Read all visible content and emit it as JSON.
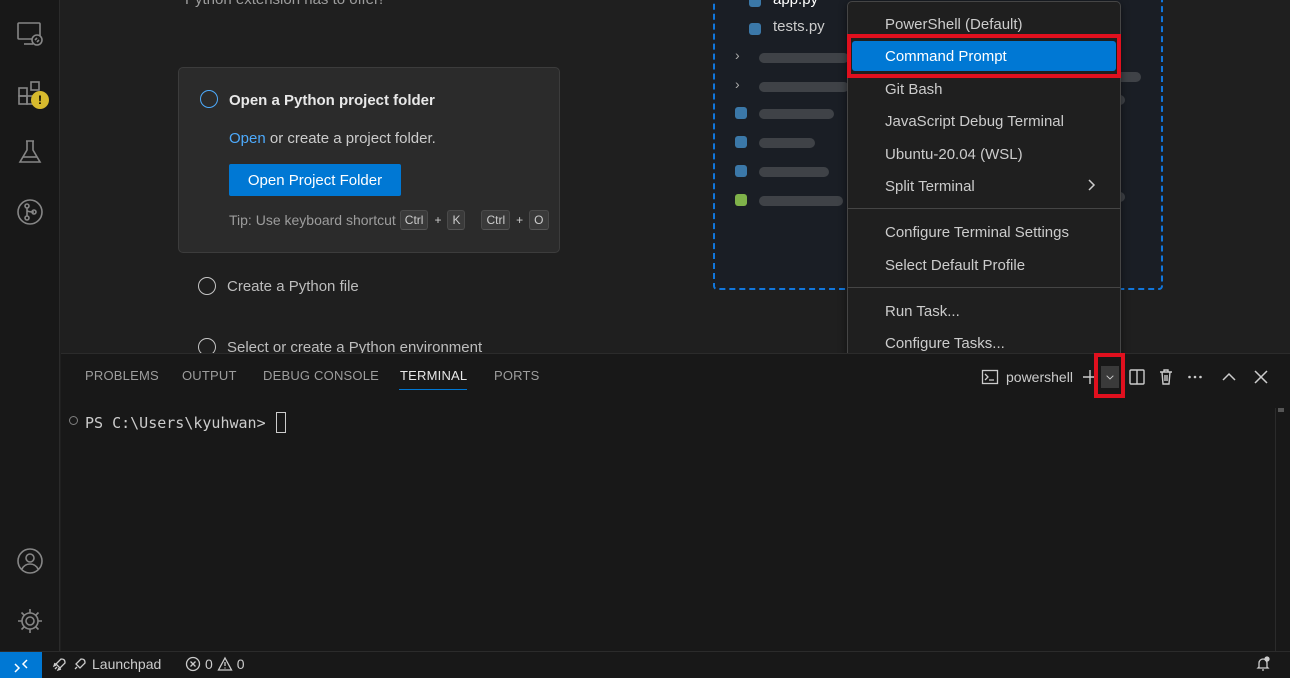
{
  "editor": {
    "truncated_text": "Python extension has to offer!",
    "card": {
      "title": "Open a Python project folder",
      "desc_link": "Open",
      "desc_rest": " or create a project folder.",
      "button": "Open Project Folder",
      "tip": "Tip: Use keyboard shortcut",
      "shortcut1": [
        "Ctrl",
        "K"
      ],
      "shortcut2": [
        "Ctrl",
        "O"
      ],
      "plus": "+"
    },
    "steps": [
      "Create a Python file",
      "Select or create a Python environment"
    ],
    "preview_files": [
      "app.py",
      "tests.py"
    ]
  },
  "menu": {
    "items": [
      {
        "label": "PowerShell (Default)"
      },
      {
        "label": "Command Prompt",
        "selected": true
      },
      {
        "label": "Git Bash"
      },
      {
        "label": "JavaScript Debug Terminal"
      },
      {
        "label": "Ubuntu-20.04 (WSL)"
      },
      {
        "label": "Split Terminal",
        "submenu": true
      }
    ],
    "items2": [
      {
        "label": "Configure Terminal Settings"
      },
      {
        "label": "Select Default Profile"
      }
    ],
    "items3": [
      {
        "label": "Run Task..."
      },
      {
        "label": "Configure Tasks..."
      }
    ]
  },
  "panel": {
    "tabs": [
      "PROBLEMS",
      "OUTPUT",
      "DEBUG CONSOLE",
      "TERMINAL",
      "PORTS"
    ],
    "active_tab": "TERMINAL",
    "terminal_name": "powershell",
    "prompt": "PS C:\\Users\\kyuhwan>"
  },
  "status": {
    "launchpad": "Launchpad",
    "errors": "0",
    "warnings": "0"
  },
  "colors": {
    "accent": "#0078d4",
    "highlight": "#e0101e",
    "warning_badge": "#d7ba2d"
  },
  "icons": {
    "activity": [
      "remote-explorer-icon",
      "extensions-icon",
      "testing-icon",
      "source-control-icon",
      "accounts-icon",
      "manage-gear-icon"
    ],
    "panel_tools": [
      "new-terminal-icon",
      "terminal-dropdown-icon",
      "split-terminal-icon",
      "kill-terminal-icon",
      "more-actions-icon",
      "maximize-panel-icon",
      "close-panel-icon"
    ]
  }
}
